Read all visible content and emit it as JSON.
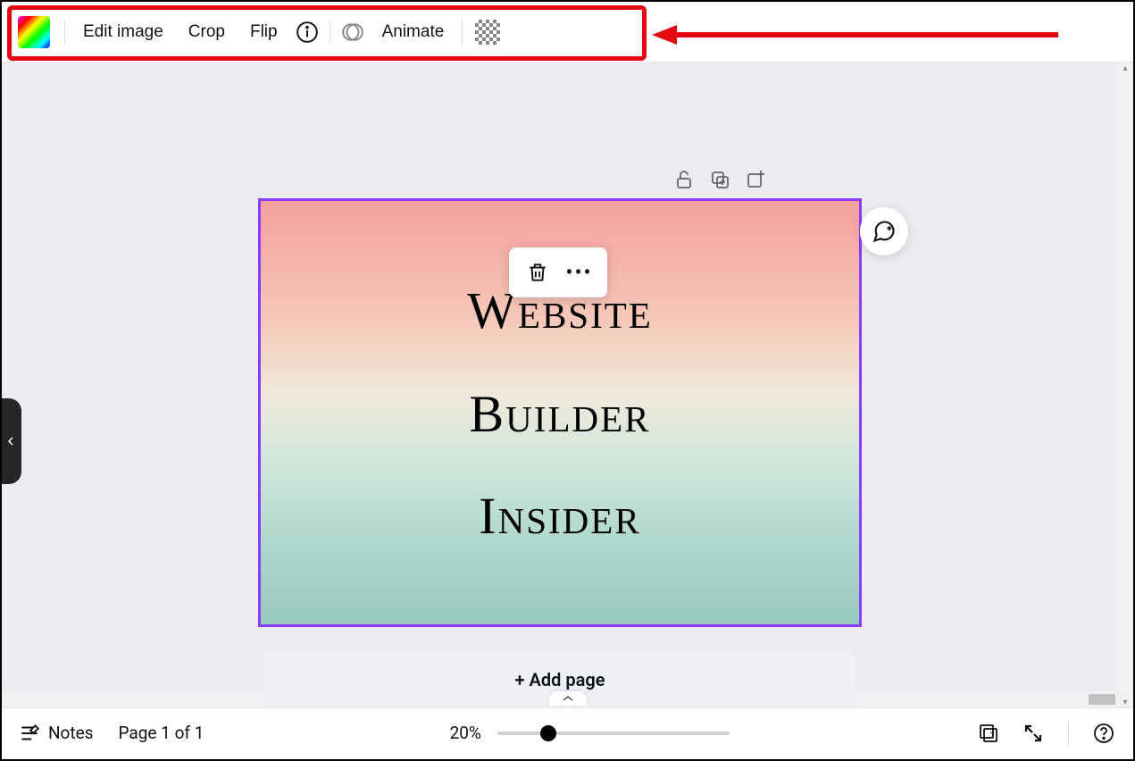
{
  "toolbar": {
    "edit_image": "Edit image",
    "crop": "Crop",
    "flip": "Flip",
    "animate": "Animate"
  },
  "canvas": {
    "text_line1": "Website",
    "text_line2": "Builder",
    "text_line3": "Insider",
    "add_page": "+ Add page"
  },
  "footer": {
    "notes": "Notes",
    "page_indicator": "Page 1 of 1",
    "zoom": "20%",
    "page_count": "1"
  },
  "annotation": {
    "highlight_color": "#e30613"
  }
}
